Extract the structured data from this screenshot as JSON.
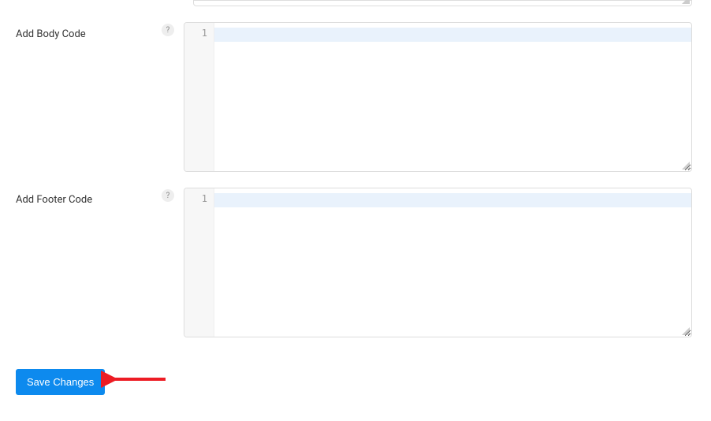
{
  "fields": {
    "body_code": {
      "label": "Add Body Code",
      "line_number": "1",
      "help": "?"
    },
    "footer_code": {
      "label": "Add Footer Code",
      "line_number": "1",
      "help": "?"
    }
  },
  "buttons": {
    "save": "Save Changes"
  }
}
